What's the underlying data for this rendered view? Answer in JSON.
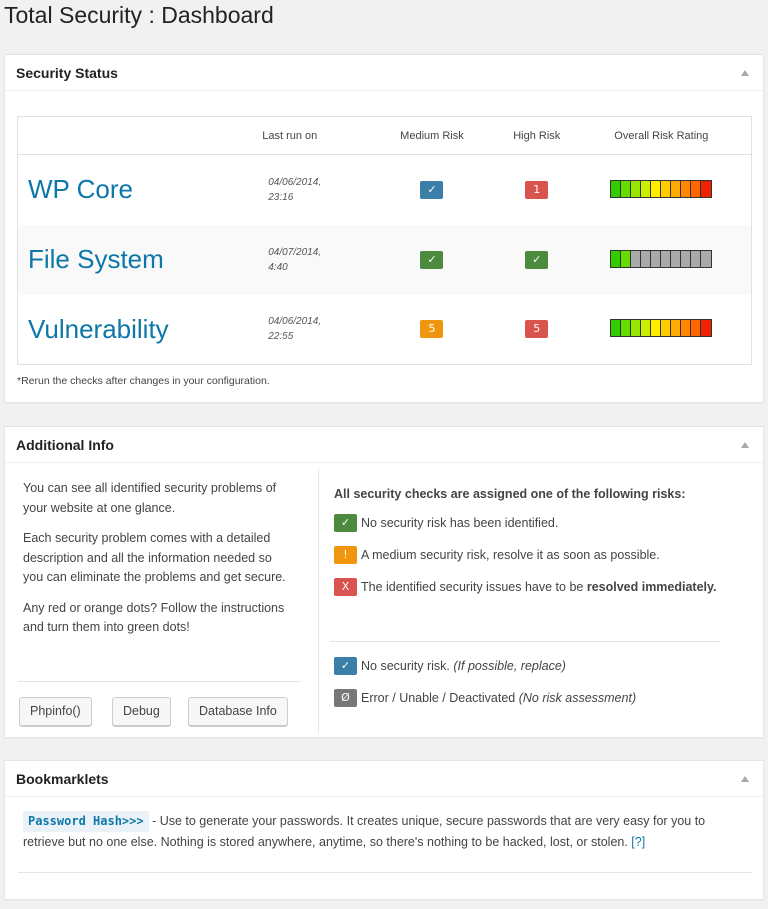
{
  "page": {
    "title": "Total Security : Dashboard"
  },
  "status_box": {
    "title": "Security Status",
    "columns": [
      "Last run on",
      "Medium Risk",
      "High Risk",
      "Overall Risk Rating"
    ],
    "rows": [
      {
        "name": "WP Core",
        "last_run_date": "04/06/2014,",
        "last_run_time": "23:16",
        "medium": "✓",
        "high": "1"
      },
      {
        "name": "File System",
        "last_run_date": "04/07/2014,",
        "last_run_time": "4:40",
        "medium": "✓",
        "high": "✓"
      },
      {
        "name": "Vulnerability",
        "last_run_date": "04/06/2014,",
        "last_run_time": "22:55",
        "medium": "5",
        "high": "5"
      }
    ],
    "note": "*Rerun the checks after changes in your configuration.",
    "colors": {
      "full_scale": [
        "#33cc00",
        "#66dd00",
        "#99e600",
        "#ccee00",
        "#ffee00",
        "#ffcc00",
        "#ffaa00",
        "#ff8800",
        "#ff6600",
        "#ee2200"
      ],
      "partial_gray": "#aaaaaa"
    }
  },
  "info_box": {
    "title": "Additional Info",
    "left_paragraphs": [
      "You can see all identified security problems of your website at one glance.",
      "Each security problem comes with a detailed description and all the information needed so you can eliminate the problems and get secure.",
      "Any red or orange dots? Follow the instructions and turn them into green dots!"
    ],
    "buttons": {
      "phpinfo": "Phpinfo()",
      "debug": "Debug",
      "database": "Database Info"
    },
    "legend_title": "All security checks are assigned one of the following risks:",
    "legend": {
      "none_badge": "✓",
      "none_text": "No security risk has been identified.",
      "medium_badge": "!",
      "medium_text": "A medium security risk, resolve it as soon as possible.",
      "high_badge": "X",
      "high_text": "The identified security issues have to be ",
      "high_bold": "resolved immediately.",
      "norisk_badge": "✓",
      "norisk_text": "No security risk. ",
      "norisk_italic": "(If possible, replace)",
      "error_badge": "Ø",
      "error_text": "Error / Unable / Deactivated ",
      "error_italic": "(No risk assessment)"
    }
  },
  "book_box": {
    "title": "Bookmarklets",
    "link": "Password Hash>>>",
    "text": " - Use to generate your passwords. It creates unique, secure passwords that are very easy for you to retrieve but no one else. Nothing is stored anywhere, anytime, so there's nothing to be hacked, lost, or stolen. ",
    "help": "[?]"
  },
  "icons": {
    "toggle": "collapse-arrow-icon"
  }
}
